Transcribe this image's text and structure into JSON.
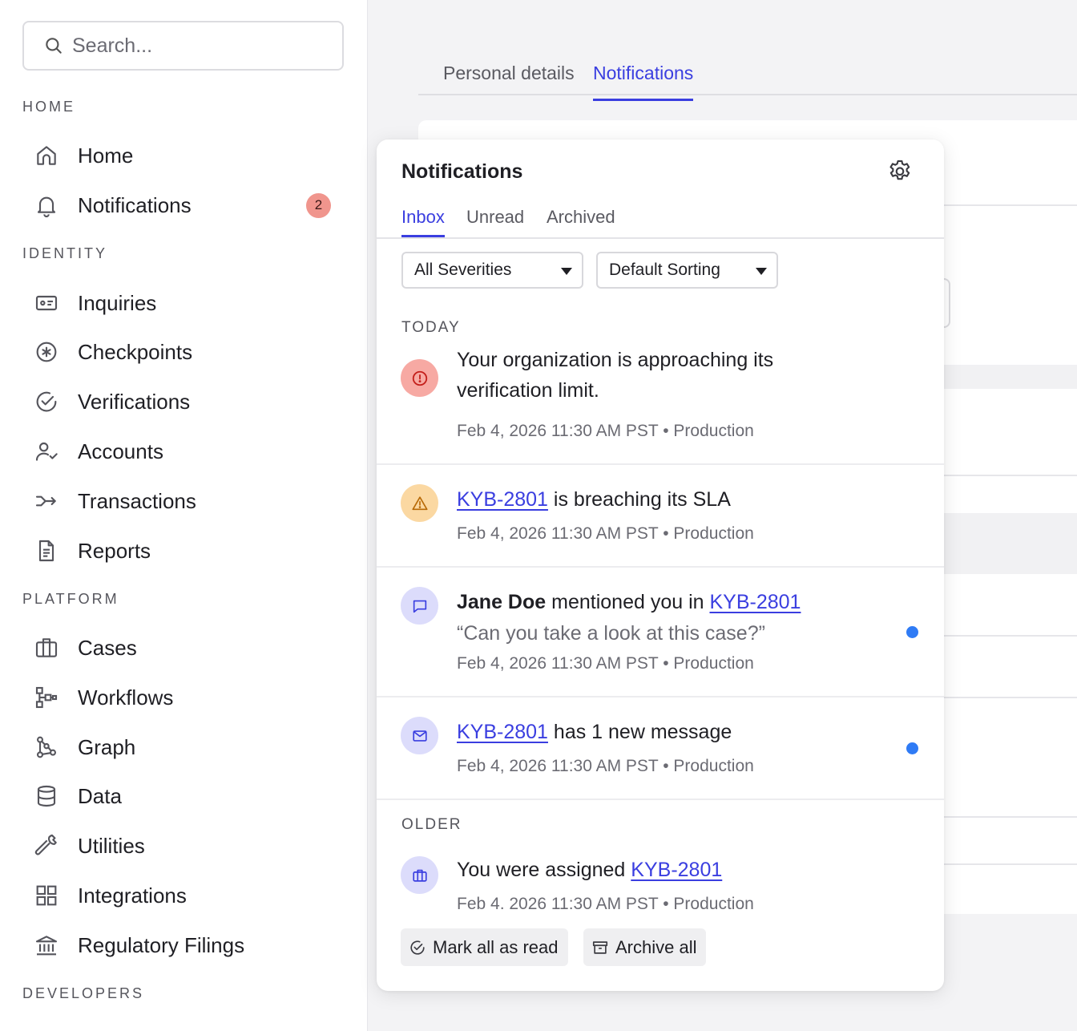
{
  "search": {
    "placeholder": "Search..."
  },
  "sidebar": {
    "sections": {
      "home": "HOME",
      "identity": "IDENTITY",
      "platform": "PLATFORM",
      "developers": "DEVELOPERS"
    },
    "items": [
      {
        "label": "Home",
        "icon": "home-icon"
      },
      {
        "label": "Notifications",
        "icon": "bell-icon",
        "badge": "2"
      },
      {
        "label": "Inquiries",
        "icon": "id-card-icon"
      },
      {
        "label": "Checkpoints",
        "icon": "asterisk-circle-icon"
      },
      {
        "label": "Verifications",
        "icon": "check-circle-icon"
      },
      {
        "label": "Accounts",
        "icon": "user-check-icon"
      },
      {
        "label": "Transactions",
        "icon": "arrow-right-icon"
      },
      {
        "label": "Reports",
        "icon": "document-icon"
      },
      {
        "label": "Cases",
        "icon": "briefcase-icon"
      },
      {
        "label": "Workflows",
        "icon": "workflow-icon"
      },
      {
        "label": "Graph",
        "icon": "graph-icon"
      },
      {
        "label": "Data",
        "icon": "database-icon"
      },
      {
        "label": "Utilities",
        "icon": "wrench-icon"
      },
      {
        "label": "Integrations",
        "icon": "grid-icon"
      },
      {
        "label": "Regulatory Filings",
        "icon": "bank-icon"
      }
    ]
  },
  "page": {
    "tabs": [
      {
        "label": "Personal details",
        "active": false
      },
      {
        "label": "Notifications",
        "active": true
      }
    ]
  },
  "panel": {
    "title": "Notifications",
    "tabs": [
      {
        "label": "Inbox",
        "active": true
      },
      {
        "label": "Unread",
        "active": false
      },
      {
        "label": "Archived",
        "active": false
      }
    ],
    "filters": {
      "severity": "All Severities",
      "sorting": "Default Sorting"
    },
    "groups": {
      "today": "TODAY",
      "older": "OLDER"
    },
    "notifications": [
      {
        "severity": "error",
        "text": "Your organization is approaching its verification limit.",
        "meta": "Feb 4, 2026 11:30 AM PST • Production",
        "unread": false
      },
      {
        "severity": "warning",
        "link": "KYB-2801",
        "text": "is breaching its SLA",
        "meta": "Feb 4, 2026 11:30 AM PST • Production",
        "unread": false
      },
      {
        "severity": "mention",
        "author": "Jane Doe",
        "text": "mentioned you in",
        "link": "KYB-2801",
        "quote": "“Can you take a look at this case?”",
        "meta": "Feb 4, 2026 11:30 AM PST • Production",
        "unread": true
      },
      {
        "severity": "message",
        "link": "KYB-2801",
        "text": "has 1 new message",
        "meta": "Feb 4, 2026 11:30 AM PST • Production",
        "unread": true
      },
      {
        "severity": "assignment",
        "text": "You were assigned",
        "link": "KYB-2801",
        "meta": "Feb 4, 2026 11:30 AM PST • Production",
        "unread": false
      }
    ],
    "actions": {
      "mark_all_read": "Mark all as read",
      "archive_all": "Archive all"
    }
  },
  "colors": {
    "accent": "#3a3ee0",
    "unread_dot": "#2f7bf5",
    "badge": "#f0958d",
    "error_bg": "#f7a9a3",
    "warning_bg": "#fbd8a2",
    "info_bg": "#dcdcfb"
  }
}
